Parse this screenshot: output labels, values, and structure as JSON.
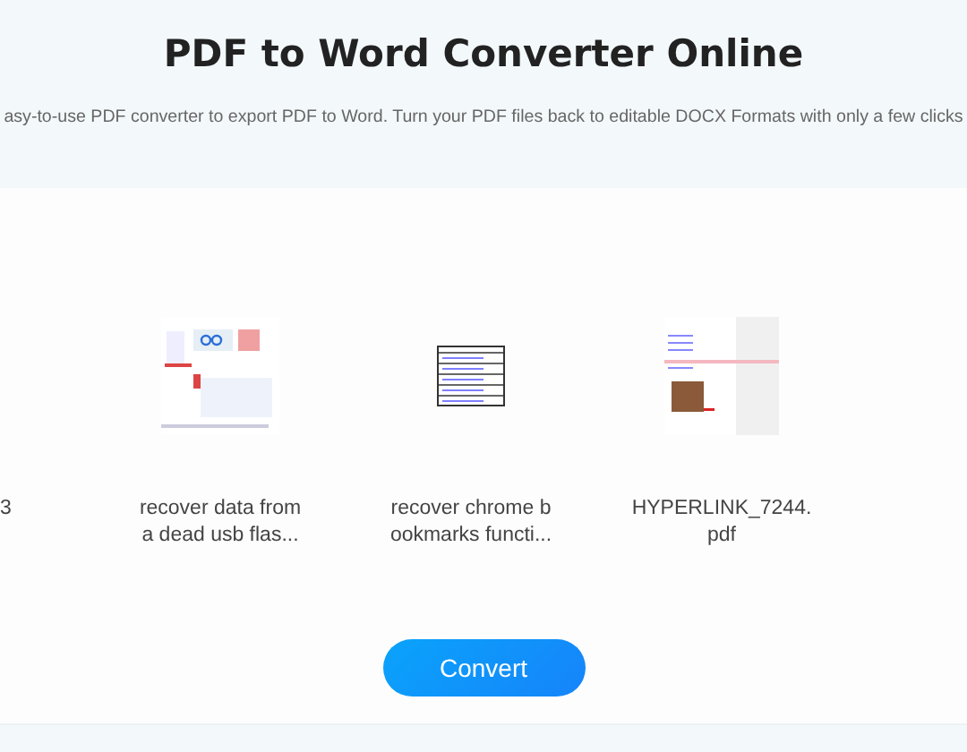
{
  "header": {
    "title": "PDF to Word Converter Online",
    "subtitle": "asy-to-use PDF converter to export PDF to Word. Turn your PDF files back to editable DOCX Formats with only a few clicks"
  },
  "files": [
    {
      "kind": "partial",
      "name": [
        "3"
      ]
    },
    {
      "kind": "screenshot",
      "name": [
        "recover data from",
        "a dead usb flas..."
      ]
    },
    {
      "kind": "table",
      "name": [
        "recover chrome b",
        "ookmarks functi..."
      ]
    },
    {
      "kind": "page-with-photo",
      "name": [
        "HYPERLINK_7244.",
        "pdf"
      ]
    }
  ],
  "convert_button": "Convert"
}
